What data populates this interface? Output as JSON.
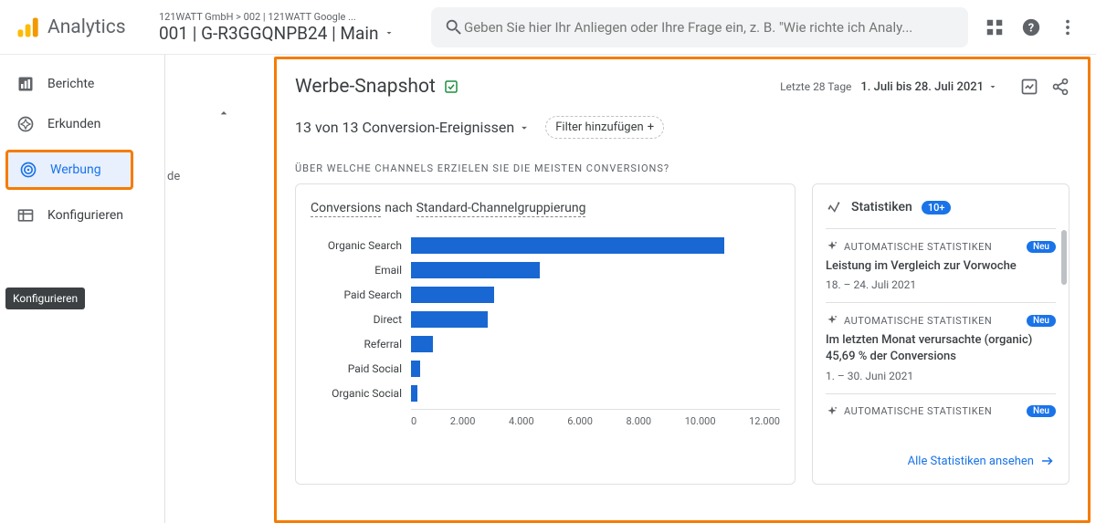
{
  "header": {
    "logo_text": "Analytics",
    "breadcrumb": "121WATT GmbH > 002 | 121WATT Google ...",
    "property": "001 | G-R3GGQNPB24 | Main",
    "search_placeholder": "Geben Sie hier Ihr Anliegen oder Ihre Frage ein, z. B. \"Wie richte ich Analy..."
  },
  "nav": {
    "items": [
      {
        "label": "Berichte",
        "icon": "bar-chart"
      },
      {
        "label": "Erkunden",
        "icon": "explore"
      },
      {
        "label": "Werbung",
        "icon": "target",
        "active": true
      },
      {
        "label": "Konfigurieren",
        "icon": "table"
      }
    ],
    "tooltip": "Konfigurieren",
    "sec_text": "de"
  },
  "main": {
    "title": "Werbe-Snapshot",
    "date_label": "Letzte 28 Tage",
    "date_value": "1. Juli bis 28. Juli 2021",
    "conv_label": "13 von 13 Conversion-Ereignissen",
    "filter_btn": "Filter hinzufügen",
    "section_q": "ÜBER WELCHE CHANNELS ERZIELEN SIE DIE MEISTEN CONVERSIONS?"
  },
  "chart_data": {
    "type": "bar",
    "title_parts": [
      "Conversions",
      " nach ",
      "Standard-Channelgruppierung"
    ],
    "categories": [
      "Organic Search",
      "Email",
      "Paid Search",
      "Direct",
      "Referral",
      "Paid Social",
      "Organic Social"
    ],
    "values": [
      10200,
      4200,
      2700,
      2500,
      700,
      300,
      200
    ],
    "xlabel": "",
    "ylabel": "",
    "xlim": [
      0,
      12000
    ],
    "ticks": [
      "0",
      "2.000",
      "4.000",
      "6.000",
      "8.000",
      "10.000",
      "12.000"
    ]
  },
  "stats": {
    "title": "Statistiken",
    "count_badge": "10+",
    "insights": [
      {
        "category": "AUTOMATISCHE STATISTIKEN",
        "badge": "Neu",
        "title": "Leistung im Vergleich zur Vorwoche",
        "date": "18. – 24. Juli 2021"
      },
      {
        "category": "AUTOMATISCHE STATISTIKEN",
        "badge": "Neu",
        "title": "Im letzten Monat verursachte (organic) 45,69 % der Conversions",
        "date": "1. – 30. Juni 2021"
      },
      {
        "category": "AUTOMATISCHE STATISTIKEN",
        "badge": "Neu",
        "title": "",
        "date": ""
      }
    ],
    "view_all": "Alle Statistiken ansehen"
  }
}
